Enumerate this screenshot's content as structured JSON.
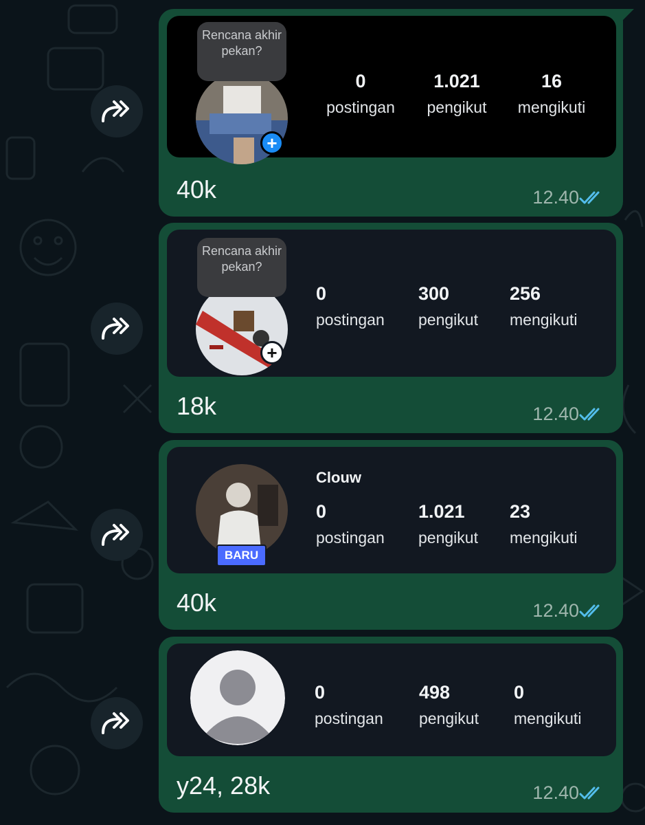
{
  "colors": {
    "bubble": "#144d37",
    "card": "#121821",
    "tick_blue": "#53bdeb",
    "badge": "#4a6bff"
  },
  "messages": [
    {
      "note": "Rencana akhir pekan?",
      "stats": [
        {
          "value": "0",
          "label": "postingan"
        },
        {
          "value": "1.021",
          "label": "pengikut"
        },
        {
          "value": "16",
          "label": "mengikuti"
        }
      ],
      "caption": "40k",
      "time": "12.40",
      "icons": {
        "forward": "forward-icon",
        "add": "add-story-icon",
        "read": "double-check-icon"
      }
    },
    {
      "note": "Rencana akhir pekan?",
      "stats": [
        {
          "value": "0",
          "label": "postingan"
        },
        {
          "value": "300",
          "label": "pengikut"
        },
        {
          "value": "256",
          "label": "mengikuti"
        }
      ],
      "caption": "18k",
      "time": "12.40",
      "icons": {
        "forward": "forward-icon",
        "add": "add-story-icon",
        "read": "double-check-icon"
      }
    },
    {
      "username": "Clouw",
      "badge": "BARU",
      "stats": [
        {
          "value": "0",
          "label": "postingan"
        },
        {
          "value": "1.021",
          "label": "pengikut"
        },
        {
          "value": "23",
          "label": "mengikuti"
        }
      ],
      "caption": "40k",
      "time": "12.40",
      "icons": {
        "forward": "forward-icon",
        "read": "double-check-icon"
      }
    },
    {
      "stats": [
        {
          "value": "0",
          "label": "postingan"
        },
        {
          "value": "498",
          "label": "pengikut"
        },
        {
          "value": "0",
          "label": "mengikuti"
        }
      ],
      "caption": "y24, 28k",
      "time": "12.40",
      "icons": {
        "forward": "forward-icon",
        "avatar": "default-avatar-icon",
        "read": "double-check-icon"
      }
    }
  ]
}
